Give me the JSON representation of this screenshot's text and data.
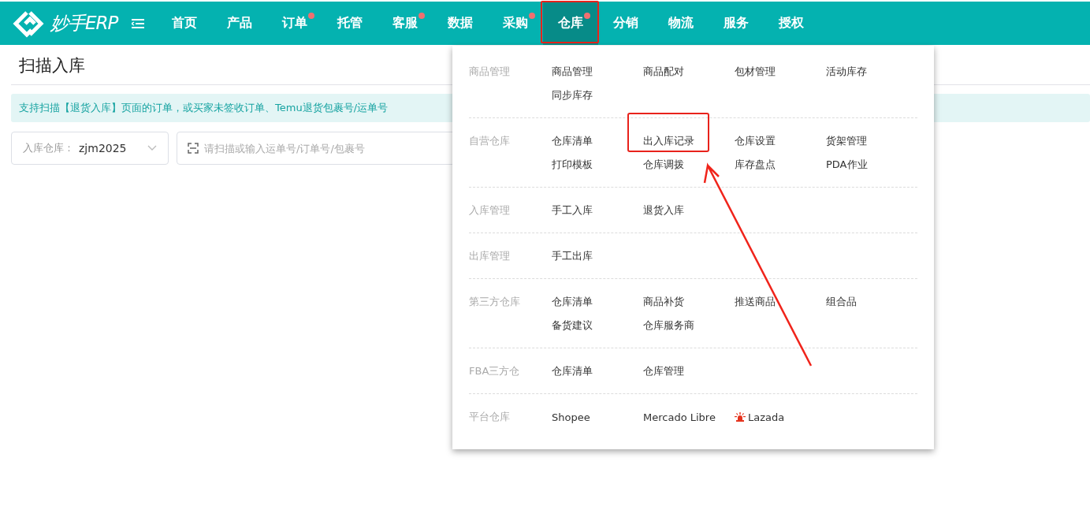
{
  "brand": {
    "name": "妙手ERP"
  },
  "nav": [
    {
      "label": "首页",
      "selected": false,
      "dot": false,
      "highlighted": false
    },
    {
      "label": "产品",
      "selected": false,
      "dot": false,
      "highlighted": false
    },
    {
      "label": "订单",
      "selected": false,
      "dot": true,
      "highlighted": false
    },
    {
      "label": "托管",
      "selected": false,
      "dot": false,
      "highlighted": false
    },
    {
      "label": "客服",
      "selected": false,
      "dot": true,
      "highlighted": false
    },
    {
      "label": "数据",
      "selected": false,
      "dot": false,
      "highlighted": false
    },
    {
      "label": "采购",
      "selected": false,
      "dot": true,
      "highlighted": false
    },
    {
      "label": "仓库",
      "selected": true,
      "dot": true,
      "highlighted": true
    },
    {
      "label": "分销",
      "selected": false,
      "dot": false,
      "highlighted": false
    },
    {
      "label": "物流",
      "selected": false,
      "dot": false,
      "highlighted": false
    },
    {
      "label": "服务",
      "selected": false,
      "dot": false,
      "highlighted": false
    },
    {
      "label": "授权",
      "selected": false,
      "dot": false,
      "highlighted": false
    }
  ],
  "page": {
    "title": "扫描入库",
    "notice": "支持扫描【退货入库】页面的订单，或买家未签收订单、Temu退货包裹号/运单号",
    "warehouse_select": {
      "label": "入库仓库：",
      "value": "zjm2025"
    },
    "scan_field": {
      "placeholder": "请扫描或输入运单号/订单号/包裹号"
    }
  },
  "menu": [
    {
      "group": "商品管理",
      "items": [
        {
          "label": "商品管理",
          "highlighted": false
        },
        {
          "label": "商品配对",
          "highlighted": false
        },
        {
          "label": "包材管理",
          "highlighted": false
        },
        {
          "label": "活动库存",
          "highlighted": false
        },
        {
          "label": "同步库存",
          "highlighted": false
        }
      ]
    },
    {
      "group": "自营仓库",
      "items": [
        {
          "label": "仓库清单",
          "highlighted": false
        },
        {
          "label": "出入库记录",
          "highlighted": true
        },
        {
          "label": "仓库设置",
          "highlighted": false
        },
        {
          "label": "货架管理",
          "highlighted": false
        },
        {
          "label": "打印模板",
          "highlighted": false
        },
        {
          "label": "仓库调拨",
          "highlighted": false
        },
        {
          "label": "库存盘点",
          "highlighted": false
        },
        {
          "label": "PDA作业",
          "highlighted": false
        }
      ]
    },
    {
      "group": "入库管理",
      "items": [
        {
          "label": "手工入库",
          "highlighted": false
        },
        {
          "label": "退货入库",
          "highlighted": false
        }
      ]
    },
    {
      "group": "出库管理",
      "items": [
        {
          "label": "手工出库",
          "highlighted": false
        }
      ]
    },
    {
      "group": "第三方仓库",
      "items": [
        {
          "label": "仓库清单",
          "highlighted": false
        },
        {
          "label": "商品补货",
          "highlighted": false
        },
        {
          "label": "推送商品",
          "highlighted": false
        },
        {
          "label": "组合品",
          "highlighted": false
        },
        {
          "label": "备货建议",
          "highlighted": false
        },
        {
          "label": "仓库服务商",
          "highlighted": false
        }
      ]
    },
    {
      "group": "FBA三方仓",
      "items": [
        {
          "label": "仓库清单",
          "highlighted": false
        },
        {
          "label": "仓库管理",
          "highlighted": false
        }
      ]
    },
    {
      "group": "平台仓库",
      "items": [
        {
          "label": "Shopee",
          "highlighted": false
        },
        {
          "label": "Mercado Libre",
          "highlighted": false
        },
        {
          "label": "Lazada",
          "highlighted": false,
          "alarm": true
        }
      ]
    }
  ]
}
